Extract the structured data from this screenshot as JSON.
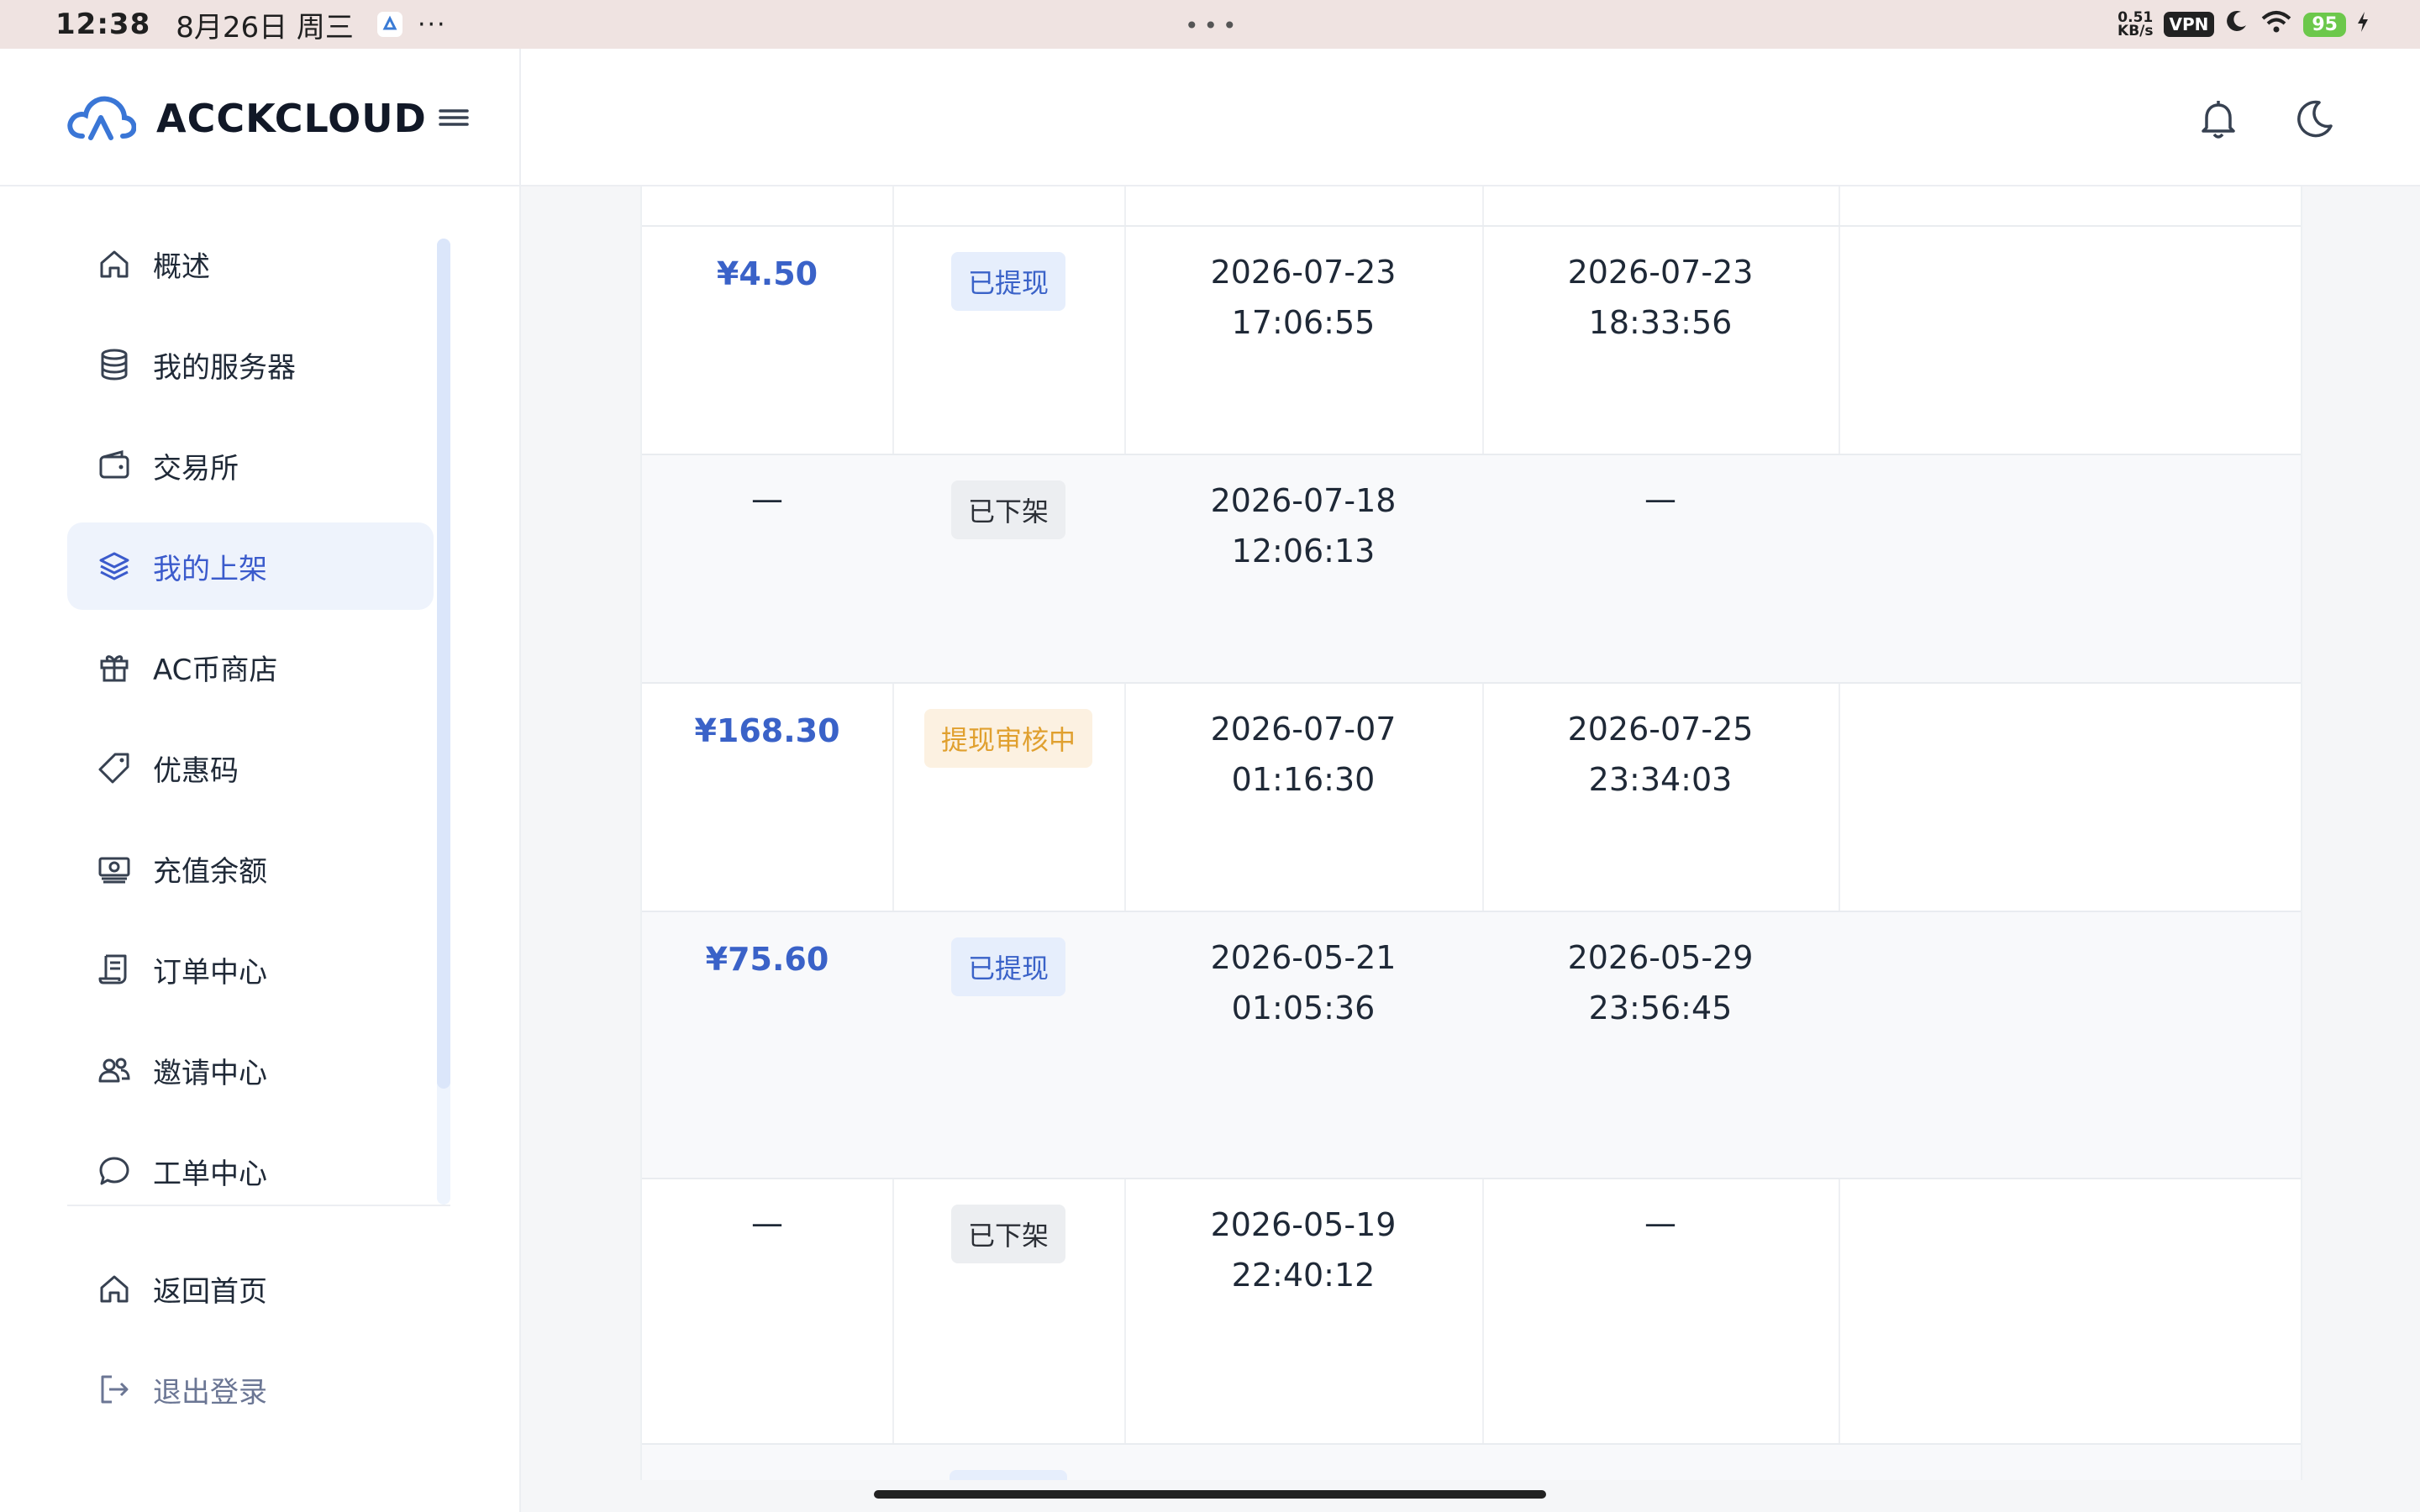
{
  "status_bar": {
    "time": "12:38",
    "date": "8月26日 周三",
    "more": "···",
    "center": "•••",
    "net_speed_value": "0.51",
    "net_speed_unit": "KB/s",
    "vpn": "VPN",
    "battery": "95"
  },
  "header": {
    "brand": "ACCKCLOUD"
  },
  "sidebar": {
    "items": [
      {
        "label": "概述",
        "icon": "home-icon"
      },
      {
        "label": "我的服务器",
        "icon": "database-icon"
      },
      {
        "label": "交易所",
        "icon": "wallet-icon"
      },
      {
        "label": "我的上架",
        "icon": "layers-icon",
        "active": true
      },
      {
        "label": "AC币商店",
        "icon": "gift-icon"
      },
      {
        "label": "优惠码",
        "icon": "tag-icon"
      },
      {
        "label": "充值余额",
        "icon": "money-icon"
      },
      {
        "label": "订单中心",
        "icon": "receipt-icon"
      },
      {
        "label": "邀请中心",
        "icon": "users-icon"
      },
      {
        "label": "工单中心",
        "icon": "chat-icon"
      }
    ],
    "bottom": [
      {
        "label": "返回首页",
        "icon": "home-icon"
      },
      {
        "label": "退出登录",
        "icon": "logout-icon"
      }
    ]
  },
  "table": {
    "rows": [
      {
        "amount": "¥4.50",
        "status": "已提现",
        "status_color": "blue",
        "listed_date": "2026-07-23",
        "listed_time": "17:06:55",
        "done_date": "2026-07-23",
        "done_time": "18:33:56"
      },
      {
        "amount": "—",
        "status": "已下架",
        "status_color": "gray",
        "listed_date": "2026-07-18",
        "listed_time": "12:06:13",
        "done_date": "—",
        "done_time": ""
      },
      {
        "amount": "¥168.30",
        "status": "提现审核中",
        "status_color": "orange",
        "listed_date": "2026-07-07",
        "listed_time": "01:16:30",
        "done_date": "2026-07-25",
        "done_time": "23:34:03"
      },
      {
        "amount": "¥75.60",
        "status": "已提现",
        "status_color": "blue",
        "listed_date": "2026-05-21",
        "listed_time": "01:05:36",
        "done_date": "2026-05-29",
        "done_time": "23:56:45"
      },
      {
        "amount": "—",
        "status": "已下架",
        "status_color": "gray",
        "listed_date": "2026-05-19",
        "listed_time": "22:40:12",
        "done_date": "—",
        "done_time": ""
      }
    ]
  },
  "colors": {
    "accent": "#3b5bcc",
    "amount": "#3a62c8",
    "status_blue_bg": "#e6eefc",
    "status_orange": "#e0a02f",
    "status_orange_bg": "#fcf1e1"
  }
}
